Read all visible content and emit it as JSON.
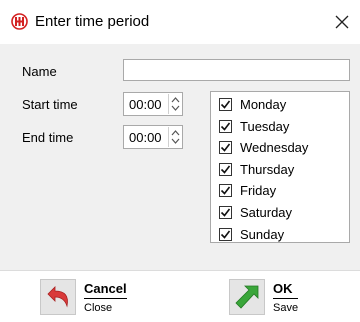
{
  "window": {
    "title": "Enter time period",
    "icon": "time-period-icon",
    "close_icon": "close-icon"
  },
  "form": {
    "name_label": "Name",
    "name_value": "",
    "start_label": "Start time",
    "start_value": "00:00",
    "end_label": "End time",
    "end_value": "00:00"
  },
  "days": [
    {
      "label": "Monday",
      "checked": true
    },
    {
      "label": "Tuesday",
      "checked": true
    },
    {
      "label": "Wednesday",
      "checked": true
    },
    {
      "label": "Thursday",
      "checked": true
    },
    {
      "label": "Friday",
      "checked": true
    },
    {
      "label": "Saturday",
      "checked": true
    },
    {
      "label": "Sunday",
      "checked": true
    }
  ],
  "footer": {
    "cancel": {
      "label": "Cancel",
      "sublabel": "Close",
      "icon": "undo-arrow-icon",
      "color": "#d93a3a"
    },
    "ok": {
      "label": "OK",
      "sublabel": "Save",
      "icon": "ok-arrow-icon",
      "color": "#3aa63a"
    }
  }
}
